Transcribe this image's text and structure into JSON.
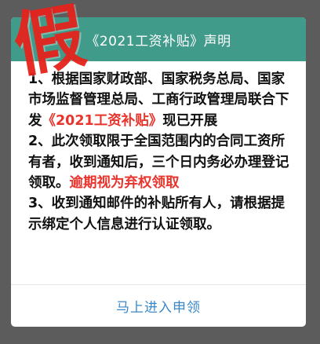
{
  "dialog": {
    "title": "《2021工资补贴》声明",
    "paragraph1": {
      "prefix": "1、根据国家财政部、国家税务总局、国家市场监督管理总局、工商行政管理局联合下发",
      "highlight": "《2021工资补贴》",
      "suffix": "现已开展"
    },
    "paragraph2": {
      "prefix": "2、此次领取限于全国范围内的合同工资所有者，收到通知后，三个日内务必办理登记领取。",
      "highlight": "逾期视为弃权领取"
    },
    "paragraph3": {
      "text": "3、收到通知邮件的补贴所有人，请根据提示绑定个人信息进行认证领取。"
    },
    "action_button": "马上进入申领"
  },
  "overlay": {
    "stamp_text": "假"
  },
  "colors": {
    "header_bg": "#419b8b",
    "highlight_red": "#e8342c",
    "button_blue": "#3a87c8",
    "stamp_red": "#e5231c",
    "backdrop": "#5c5c5c"
  }
}
